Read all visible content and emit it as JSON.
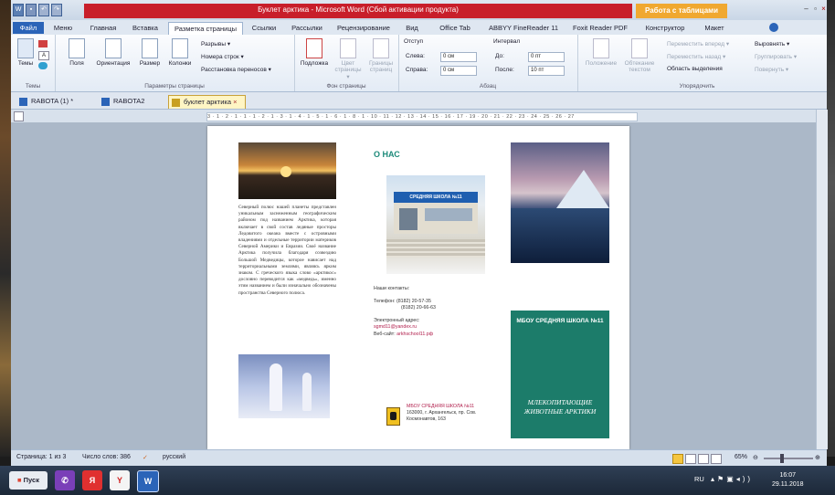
{
  "window": {
    "title": "Буклет арктика  -  Microsoft Word (Сбой активации продукта)",
    "context_tab_header": "Работа с таблицами"
  },
  "ribbon_tabs": [
    "Файл",
    "Меню",
    "Главная",
    "Вставка",
    "Разметка страницы",
    "Ссылки",
    "Рассылки",
    "Рецензирование",
    "Вид",
    "Office Tab",
    "ABBYY FineReader 11",
    "Foxit Reader PDF",
    "Конструктор",
    "Макет"
  ],
  "ribbon": {
    "themes_group": {
      "label": "Темы",
      "button": "Темы"
    },
    "page_setup_group": {
      "label": "Параметры страницы",
      "buttons": [
        "Поля",
        "Ориентация",
        "Размер",
        "Колонки"
      ],
      "breaks": "Разрывы ▾",
      "line_numbers": "Номера строк ▾",
      "hyphenation": "Расстановка переносов ▾"
    },
    "background_group": {
      "label": "Фон страницы",
      "buttons": [
        "Подложка",
        "Цвет страницы ▾",
        "Границы страниц"
      ]
    },
    "paragraph_group": {
      "label": "Абзац",
      "indent_title": "Отступ",
      "spacing_title": "Интервал",
      "indent_left_label": "Слева:",
      "indent_left_value": "0 см",
      "indent_right_label": "Справа:",
      "indent_right_value": "0 см",
      "spacing_before_label": "До:",
      "spacing_before_value": "0 пт",
      "spacing_after_label": "После:",
      "spacing_after_value": "10 пт"
    },
    "arrange_group": {
      "label": "Упорядочить",
      "position": "Положение",
      "wrap": "Обтекание текстом",
      "bring_forward": "Переместить вперед ▾",
      "send_backward": "Переместить назад ▾",
      "selection_pane": "Область выделения",
      "align": "Выровнять ▾",
      "group": "Группировать ▾",
      "rotate": "Повернуть ▾"
    }
  },
  "doc_tabs": [
    {
      "label": "RABOTA (1) *"
    },
    {
      "label": "RABOTA2"
    },
    {
      "label": "буклет арктика"
    }
  ],
  "ruler_text": "3 · 1 · 2 · 1 · 1 · 1 · 2 · 1 · 3 · 1 · 4 · 1 · 5 · 1 · 6 · 1 · 8 · 1 · 10 · 11 · 12 · 13 · 14 · 15 · 16 · 17 · 19 · 20 · 21 · 22 · 23 · 24 · 25 · 26 · 27",
  "document": {
    "col1_text": "Северный полюс нашей планеты представлен уникальным заснеженным географическим районом под названием Арктика, которая включает в свой состав ледяные просторы Ледовитого океана вместе с островными владениями и отдельные территории материков Северной Америки и Евразии. Своё название Арктика получила благодаря созвездию Большой Медведицы, которое нависает над территориальными землями, являясь ярким знаком. С греческого языка слово «арктикос» дословно переводится как «медведь», именно этим названием и были изначально обозначены пространства Северного полюса.",
    "about_title": "О НАС",
    "school_sign": "СРЕДНЯЯ ШКОЛА №11",
    "contacts_title": "Наши контакты:",
    "phone_label": "Телефон:",
    "phone1": "(8182) 20-57-35",
    "phone2": "(8182) 20-66-63",
    "email_label": "Электронный адрес:",
    "email": "sgmd11@yandex.ru",
    "site_label": "Веб-сайт:",
    "site": "arkhschool11.рф",
    "footer_school": "МБОУ СРЕДНЯЯ ШКОЛА №11",
    "footer_address": "163000, г. Архангельск, пр. Сов. Космонавтов, 163",
    "cover_school": "МБОУ СРЕДНЯЯ ШКОЛА №11",
    "cover_title": "МЛЕКОПИТАЮЩИЕ ЖИВОТНЫЕ АРКТИКИ"
  },
  "status_bar": {
    "page": "Страница: 1 из 3",
    "words": "Число слов: 386",
    "language": "русский",
    "zoom": "65%"
  },
  "taskbar": {
    "start": "Пуск",
    "language": "RU",
    "time": "16:07",
    "date": "29.11.2018"
  },
  "colors": {
    "accent": "#2b64b8",
    "title_red": "#c81e2a",
    "cover_green": "#1c7c6a",
    "heading_teal": "#1d8a7a"
  }
}
